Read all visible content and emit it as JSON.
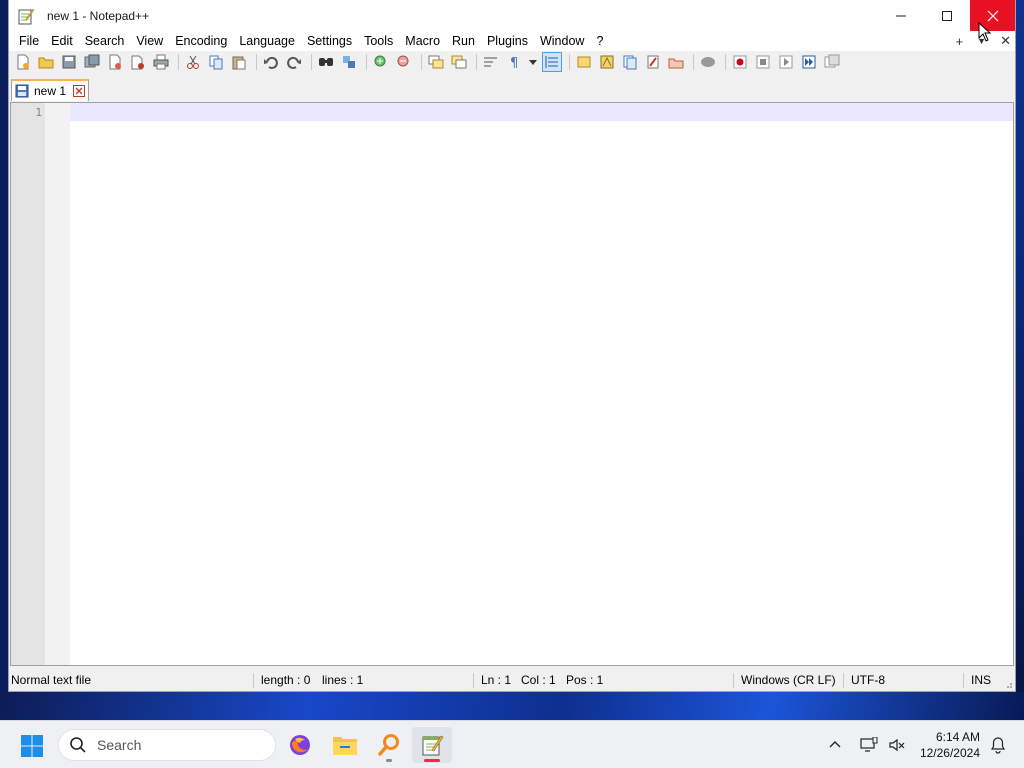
{
  "window": {
    "title": "new 1 - Notepad++",
    "minimize_glyph": "—",
    "maximize_glyph": "☐",
    "close_glyph": "✕"
  },
  "menubar": {
    "items": [
      "File",
      "Edit",
      "Search",
      "View",
      "Encoding",
      "Language",
      "Settings",
      "Tools",
      "Macro",
      "Run",
      "Plugins",
      "Window",
      "?"
    ],
    "right_add": "+",
    "right_dropdown": "▼",
    "right_close": "✕"
  },
  "toolbar": {
    "icons": [
      "new-file-icon",
      "open-file-icon",
      "save-icon",
      "save-all-icon",
      "close-icon",
      "close-all-icon",
      "print-icon",
      "cut-icon",
      "copy-icon",
      "paste-icon",
      "undo-icon",
      "redo-icon",
      "find-icon",
      "replace-icon",
      "zoom-in-icon",
      "zoom-out-icon",
      "sync-vertical-icon",
      "sync-horizontal-icon",
      "word-wrap-icon",
      "show-all-characters-icon",
      "indent-guide-icon",
      "user-language-icon",
      "doc-map-icon",
      "function-list-icon",
      "folder-workspace-icon",
      "monitoring-icon",
      "record-macro-icon",
      "stop-macro-icon",
      "play-macro-icon",
      "run-macro-multiple-icon",
      "save-macro-icon"
    ]
  },
  "tab": {
    "label": "new 1"
  },
  "editor": {
    "line_number": "1"
  },
  "statusbar": {
    "file_type": "Normal text file",
    "length": "length : 0",
    "lines": "lines : 1",
    "ln": "Ln : 1",
    "col": "Col : 1",
    "pos": "Pos : 1",
    "eol": "Windows (CR LF)",
    "encoding": "UTF-8",
    "mode": "INS"
  },
  "taskbar": {
    "search_placeholder": "Search",
    "apps": [
      "firefox-icon",
      "file-explorer-icon",
      "search-tool-icon",
      "notepadpp-icon"
    ],
    "time": "6:14 AM",
    "date": "12/26/2024"
  },
  "colors": {
    "close_red": "#e81123",
    "tab_accent": "#f7b34a",
    "current_line": "#e8e8ff"
  }
}
